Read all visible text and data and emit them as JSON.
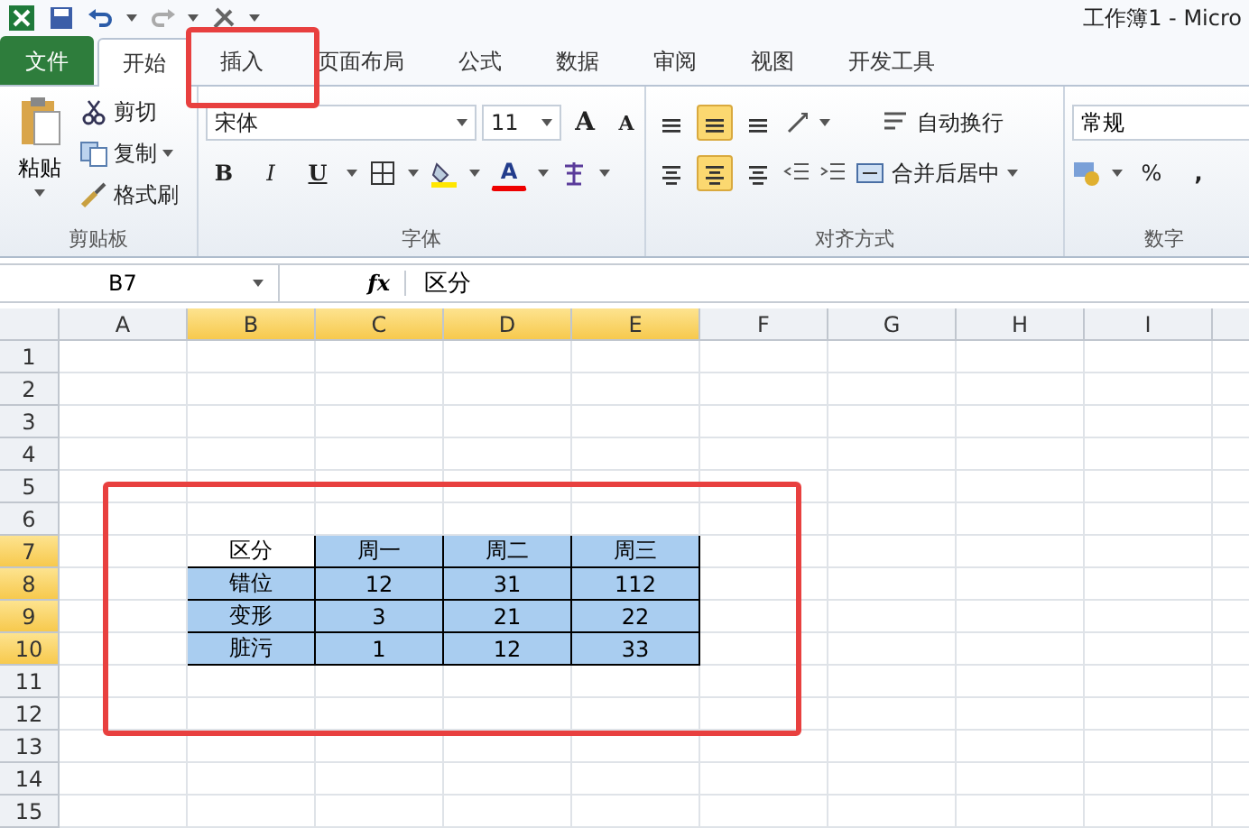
{
  "title": "工作簿1 - Micro",
  "tabs": [
    {
      "label": "文件",
      "kind": "file",
      "selected": false
    },
    {
      "label": "开始",
      "kind": "tab",
      "selected": true
    },
    {
      "label": "插入",
      "kind": "tab",
      "selected": false
    },
    {
      "label": "页面布局",
      "kind": "tab",
      "selected": false
    },
    {
      "label": "公式",
      "kind": "tab",
      "selected": false
    },
    {
      "label": "数据",
      "kind": "tab",
      "selected": false
    },
    {
      "label": "审阅",
      "kind": "tab",
      "selected": false
    },
    {
      "label": "视图",
      "kind": "tab",
      "selected": false
    },
    {
      "label": "开发工具",
      "kind": "tab",
      "selected": false
    }
  ],
  "clipboard": {
    "paste": "粘贴",
    "cut": "剪切",
    "copy": "复制",
    "painter": "格式刷",
    "label": "剪贴板"
  },
  "font": {
    "name": "宋体",
    "size": "11",
    "grow": "A",
    "shrink": "A",
    "bold": "B",
    "italic": "I",
    "underline": "U",
    "font_color": "A",
    "label": "字体"
  },
  "alignment": {
    "vertical": [
      {
        "selected": false
      },
      {
        "selected": true
      },
      {
        "selected": false
      }
    ],
    "horizontal": [
      {
        "selected": false
      },
      {
        "selected": true
      },
      {
        "selected": false
      }
    ],
    "wrap": "自动换行",
    "merge": "合并后居中",
    "label": "对齐方式"
  },
  "number": {
    "format": "常规",
    "percent": "%",
    "comma": ",",
    "label": "数字"
  },
  "formula_bar": {
    "name_box": "B7",
    "fx": "fx",
    "content": "区分"
  },
  "columns": [
    {
      "label": "A",
      "selected": false
    },
    {
      "label": "B",
      "selected": true
    },
    {
      "label": "C",
      "selected": true
    },
    {
      "label": "D",
      "selected": true
    },
    {
      "label": "E",
      "selected": true
    },
    {
      "label": "F",
      "selected": false
    },
    {
      "label": "G",
      "selected": false
    },
    {
      "label": "H",
      "selected": false
    },
    {
      "label": "I",
      "selected": false
    }
  ],
  "rows": [
    {
      "label": "1",
      "selected": false
    },
    {
      "label": "2",
      "selected": false
    },
    {
      "label": "3",
      "selected": false
    },
    {
      "label": "4",
      "selected": false
    },
    {
      "label": "5",
      "selected": false
    },
    {
      "label": "6",
      "selected": false
    },
    {
      "label": "7",
      "selected": true
    },
    {
      "label": "8",
      "selected": true
    },
    {
      "label": "9",
      "selected": true
    },
    {
      "label": "10",
      "selected": true
    },
    {
      "label": "11",
      "selected": false
    },
    {
      "label": "12",
      "selected": false
    },
    {
      "label": "13",
      "selected": false
    },
    {
      "label": "14",
      "selected": false
    },
    {
      "label": "15",
      "selected": false
    }
  ],
  "table": [
    [
      "区分",
      "周一",
      "周二",
      "周三"
    ],
    [
      "错位",
      "12",
      "31",
      "112"
    ],
    [
      "变形",
      "3",
      "21",
      "22"
    ],
    [
      "脏污",
      "1",
      "12",
      "33"
    ]
  ]
}
